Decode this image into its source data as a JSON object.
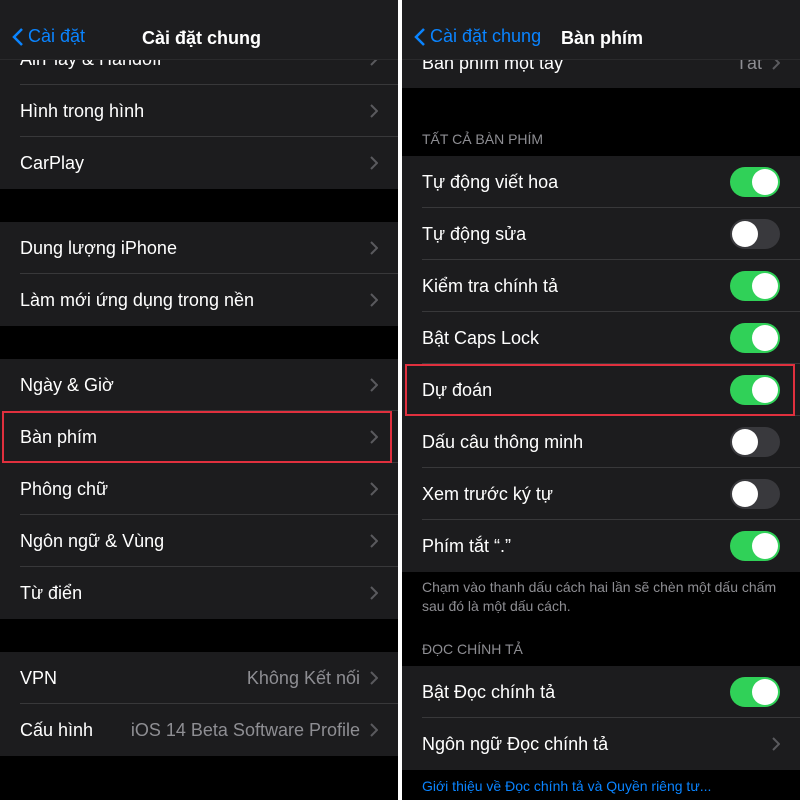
{
  "left": {
    "back_label": "Cài đặt",
    "title": "Cài đặt chung",
    "rows": [
      {
        "label": "AirPlay & Handoff",
        "value": ""
      },
      {
        "label": "Hình trong hình",
        "value": ""
      },
      {
        "label": "CarPlay",
        "value": ""
      },
      {
        "label": "Dung lượng iPhone",
        "value": ""
      },
      {
        "label": "Làm mới ứng dụng trong nền",
        "value": ""
      },
      {
        "label": "Ngày & Giờ",
        "value": ""
      },
      {
        "label": "Bàn phím",
        "value": "",
        "highlighted": true
      },
      {
        "label": "Phông chữ",
        "value": ""
      },
      {
        "label": "Ngôn ngữ & Vùng",
        "value": ""
      },
      {
        "label": "Từ điển",
        "value": ""
      },
      {
        "label": "VPN",
        "value": "Không Kết nối"
      },
      {
        "label": "Cấu hình",
        "value": "iOS 14 Beta Software Profile"
      }
    ]
  },
  "right": {
    "back_label": "Cài đặt chung",
    "title": "Bàn phím",
    "one_hand": {
      "label": "Bàn phím một tay",
      "value": "Tắt"
    },
    "all_keyboards_header": "TẤT CẢ BÀN PHÍM",
    "toggles": [
      {
        "label": "Tự động viết hoa",
        "on": true
      },
      {
        "label": "Tự động sửa",
        "on": false
      },
      {
        "label": "Kiểm tra chính tả",
        "on": true
      },
      {
        "label": "Bật Caps Lock",
        "on": true
      },
      {
        "label": "Dự đoán",
        "on": true,
        "highlighted": true
      },
      {
        "label": "Dấu câu thông minh",
        "on": false
      },
      {
        "label": "Xem trước ký tự",
        "on": false
      },
      {
        "label": "Phím tắt “.”",
        "on": true
      }
    ],
    "shortcut_footer": "Chạm vào thanh dấu cách hai lần sẽ chèn một dấu chấm sau đó là một dấu cách.",
    "dictation_header": "ĐỌC CHÍNH TẢ",
    "dictation_toggle": {
      "label": "Bật Đọc chính tả",
      "on": true
    },
    "dictation_language": {
      "label": "Ngôn ngữ Đọc chính tả"
    },
    "privacy_link": "Giới thiệu về Đọc chính tả và Quyền riêng tư..."
  },
  "colors": {
    "accent": "#0a84ff",
    "toggle_on": "#30d158",
    "highlight": "#e0303e"
  }
}
